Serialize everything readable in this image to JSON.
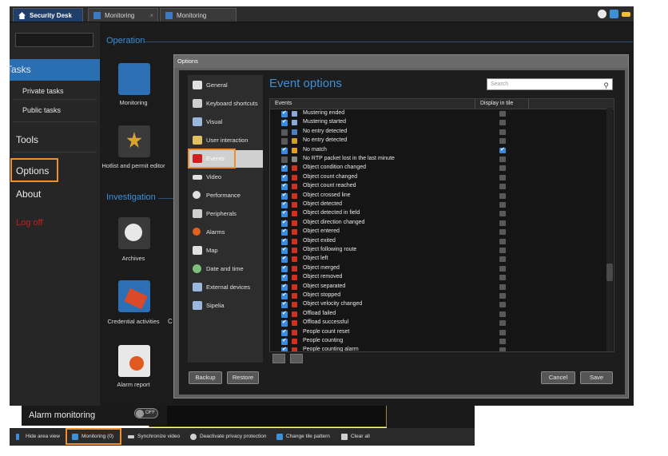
{
  "topbar": {
    "home_tab": "Security Desk",
    "tabs": [
      {
        "label": "Monitoring"
      },
      {
        "label": "Monitoring"
      }
    ],
    "close_glyph": "×",
    "icons": [
      "settings-icon",
      "notification-icon",
      "key-icon"
    ]
  },
  "sidebar": {
    "items": [
      {
        "label": "Tasks"
      },
      {
        "label": "Private tasks"
      },
      {
        "label": "Public tasks"
      },
      {
        "label": "Tools"
      },
      {
        "label": "Options"
      },
      {
        "label": "About"
      },
      {
        "label": "Log off"
      }
    ]
  },
  "main": {
    "operation_title": "Operation",
    "investigation_title": "Investigation",
    "tasks": [
      {
        "label": "Monitoring",
        "icon": "monitoring-icon"
      },
      {
        "label": "Hotlist and permit editor",
        "icon": "badge-icon"
      },
      {
        "label": "Archives",
        "icon": "film-reel-icon"
      },
      {
        "label": "Credential activities",
        "icon": "credential-icon"
      },
      {
        "label": "Alarm report",
        "icon": "alarm-report-icon"
      }
    ],
    "cut_text": "C"
  },
  "dialog": {
    "title": "Options",
    "nav": [
      {
        "label": "General",
        "icon": "general-icon"
      },
      {
        "label": "Keyboard shortcuts",
        "icon": "keyboard-icon"
      },
      {
        "label": "Visual",
        "icon": "visual-icon"
      },
      {
        "label": "User interaction",
        "icon": "user-interaction-icon"
      },
      {
        "label": "Events",
        "icon": "events-flag-icon"
      },
      {
        "label": "Video",
        "icon": "video-icon"
      },
      {
        "label": "Performance",
        "icon": "performance-icon"
      },
      {
        "label": "Peripherals",
        "icon": "peripherals-icon"
      },
      {
        "label": "Alarms",
        "icon": "alarm-icon"
      },
      {
        "label": "Map",
        "icon": "map-icon"
      },
      {
        "label": "Date and time",
        "icon": "clock-icon"
      },
      {
        "label": "External devices",
        "icon": "external-devices-icon"
      },
      {
        "label": "Sipelia",
        "icon": "sipelia-icon"
      }
    ],
    "selected_nav": "Events",
    "event_options_title": "Event options",
    "search_placeholder": "Search",
    "columns": {
      "events": "Events",
      "display_in_tile": "Display in tile"
    },
    "events": [
      {
        "label": "Mustering ended",
        "enabled": true,
        "display": false
      },
      {
        "label": "Mustering started",
        "enabled": true,
        "display": false
      },
      {
        "label": "No entry detected",
        "enabled": false,
        "display": false
      },
      {
        "label": "No entry detected",
        "enabled": false,
        "display": false
      },
      {
        "label": "No match",
        "enabled": true,
        "display": true
      },
      {
        "label": "No RTP packet lost in the last minute",
        "enabled": false,
        "display": false
      },
      {
        "label": "Object condition changed",
        "enabled": true,
        "display": false
      },
      {
        "label": "Object count changed",
        "enabled": true,
        "display": false
      },
      {
        "label": "Object count reached",
        "enabled": true,
        "display": false
      },
      {
        "label": "Object crossed line",
        "enabled": true,
        "display": false
      },
      {
        "label": "Object detected",
        "enabled": true,
        "display": false
      },
      {
        "label": "Object detected in field",
        "enabled": true,
        "display": false
      },
      {
        "label": "Object direction changed",
        "enabled": true,
        "display": false
      },
      {
        "label": "Object entered",
        "enabled": true,
        "display": false
      },
      {
        "label": "Object exited",
        "enabled": true,
        "display": false
      },
      {
        "label": "Object following route",
        "enabled": true,
        "display": false
      },
      {
        "label": "Object left",
        "enabled": true,
        "display": false
      },
      {
        "label": "Object merged",
        "enabled": true,
        "display": false
      },
      {
        "label": "Object removed",
        "enabled": true,
        "display": false
      },
      {
        "label": "Object separated",
        "enabled": true,
        "display": false
      },
      {
        "label": "Object stopped",
        "enabled": true,
        "display": false
      },
      {
        "label": "Object velocity changed",
        "enabled": true,
        "display": false
      },
      {
        "label": "Offload failed",
        "enabled": true,
        "display": false
      },
      {
        "label": "Offload successful",
        "enabled": true,
        "display": false
      },
      {
        "label": "People count reset",
        "enabled": true,
        "display": false
      },
      {
        "label": "People counting",
        "enabled": true,
        "display": false
      },
      {
        "label": "People counting alarm",
        "enabled": true,
        "display": false
      }
    ],
    "buttons": {
      "backup": "Backup",
      "restore": "Restore",
      "cancel": "Cancel",
      "save": "Save"
    }
  },
  "bottom": {
    "alarm_monitoring": "Alarm monitoring",
    "toggle_label": "OFF",
    "bar_items": [
      {
        "label": "Hide area view",
        "icon": "chevron-left-icon"
      },
      {
        "label": "Monitoring (0)",
        "icon": "monitoring-small-icon"
      },
      {
        "label": "Synchronize video",
        "icon": "sync-icon"
      },
      {
        "label": "Deactivate privacy protection",
        "icon": "eye-icon"
      },
      {
        "label": "Change tile pattern",
        "icon": "tile-pattern-icon"
      },
      {
        "label": "Clear all",
        "icon": "clear-all-icon"
      }
    ]
  },
  "colors": {
    "accent": "#3d8fd8",
    "highlight_box": "#f0902c",
    "logoff": "#c02020",
    "selected_task": "#2b6fb3"
  }
}
